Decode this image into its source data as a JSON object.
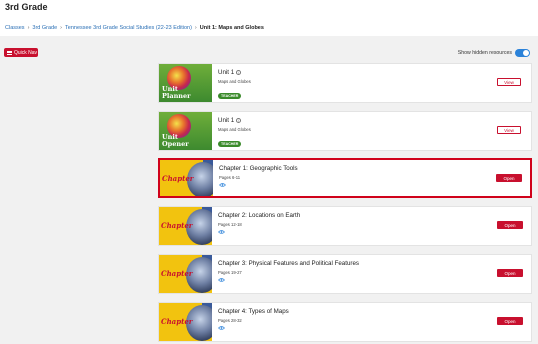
{
  "header": {
    "title": "3rd Grade",
    "breadcrumb": [
      "Classes",
      "3rd Grade",
      "Tennessee 3rd Grade Social Studies (22-23 Edition)"
    ],
    "breadcrumb_current": "Unit 1: Maps and Globes"
  },
  "toolbar": {
    "quick_nav_label": "Quick Nav",
    "hidden_toggle_label": "Show hidden resources",
    "hidden_toggle_on": true
  },
  "colors": {
    "accent": "#c8102e",
    "toggle": "#2b82d9",
    "teacher_badge": "#3a8a2a",
    "link": "#2a6fb5"
  },
  "resources": [
    {
      "thumb_text": "Unit\nPlanner",
      "title": "Unit 1",
      "subtitle": "Maps and Globes",
      "badge": "TEACHER",
      "action": "View"
    },
    {
      "thumb_text": "Unit\nOpener",
      "title": "Unit 1",
      "subtitle": "Maps and Globes",
      "badge": "TEACHER",
      "action": "View"
    },
    {
      "thumb_text": "Chapter",
      "title": "Chapter 1: Geographic Tools",
      "subtitle": "Pages 6-11",
      "action": "Open",
      "selected": true
    },
    {
      "thumb_text": "Chapter",
      "title": "Chapter 2: Locations on Earth",
      "subtitle": "Pages 12-18",
      "action": "Open"
    },
    {
      "thumb_text": "Chapter",
      "title": "Chapter 3: Physical Features and Political Features",
      "subtitle": "Pages 19-27",
      "action": "Open"
    },
    {
      "thumb_text": "Chapter",
      "title": "Chapter 4: Types of Maps",
      "subtitle": "Pages 28-32",
      "action": "Open"
    }
  ]
}
